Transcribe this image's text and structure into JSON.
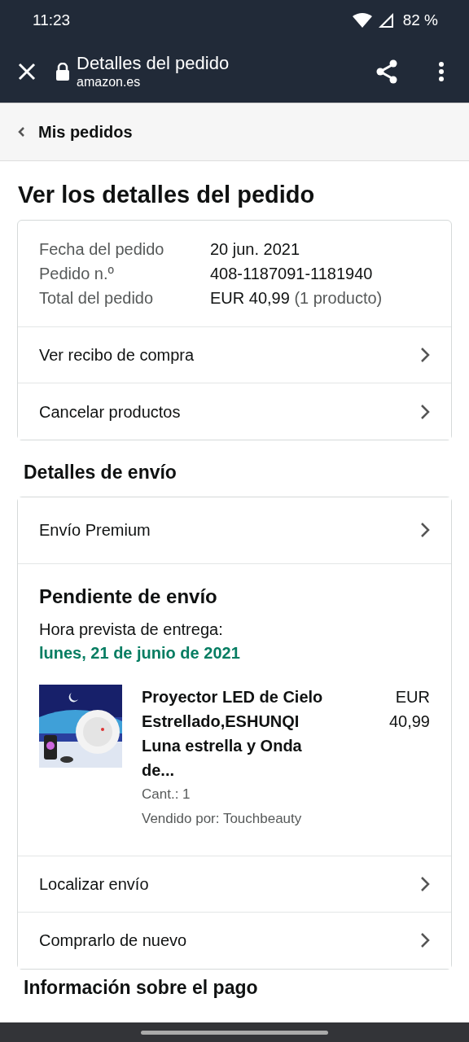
{
  "status_bar": {
    "time": "11:23",
    "battery": "82 %"
  },
  "browser_bar": {
    "title": "Detalles del pedido",
    "domain": "amazon.es"
  },
  "breadcrumb": {
    "label": "Mis pedidos"
  },
  "heading": "Ver los detalles del pedido",
  "summary": {
    "rows": [
      {
        "label": "Fecha del pedido",
        "value": "20 jun. 2021"
      },
      {
        "label": "Pedido n.º",
        "value": "408-1187091-1181940"
      },
      {
        "label": "Total del pedido",
        "value": "EUR 40,99",
        "note": "(1 producto)"
      }
    ],
    "links": [
      "Ver recibo de compra",
      "Cancelar productos"
    ]
  },
  "shipping": {
    "heading": "Detalles de envío",
    "method": "Envío Premium",
    "status": "Pendiente de envío",
    "eta_label": "Hora prevista de entrega:",
    "eta_date": "lunes, 21 de junio de 2021",
    "item": {
      "kind": "picture",
      "title": "Proyector LED de Cielo Estrellado,ESHUNQI Luna estrella y Onda de...",
      "price": "EUR 40,99",
      "quantity": "Cant.: 1",
      "seller": "Vendido por: Touchbeauty"
    },
    "links": [
      "Localizar envío",
      "Comprarlo de nuevo"
    ]
  },
  "next_heading": "Información sobre el pago"
}
